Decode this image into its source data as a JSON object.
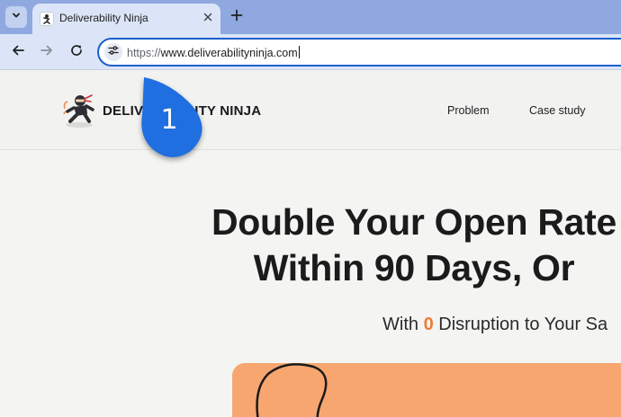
{
  "browser": {
    "tab": {
      "title": "Deliverability Ninja"
    },
    "address_bar": {
      "scheme": "https://",
      "host": "www.deliverabilityninja.com"
    }
  },
  "site": {
    "logo_text": "DELIVERABILITY NINJA",
    "nav": [
      "Problem",
      "Case study"
    ]
  },
  "hero": {
    "title_line1": "Double Your Open Rate",
    "title_line2": "Within 90 Days, Or",
    "subtitle_prefix": "With ",
    "subtitle_highlight": "0",
    "subtitle_suffix": " Disruption to Your Sa"
  },
  "annotation": {
    "step_number": "1"
  },
  "colors": {
    "tabstrip": "#8fa9e0",
    "toolbar": "#dbe5f7",
    "omnibox_focus": "#1b5fcc",
    "callout": "#1f6fe0",
    "highlight_orange": "#f07a33",
    "card_orange": "#f7a670"
  },
  "icons": {
    "tab_search": "chevron-down-icon",
    "tab_close": "close-icon",
    "new_tab": "plus-icon",
    "back": "arrow-left-icon",
    "forward": "arrow-right-icon",
    "reload": "reload-icon",
    "site_info": "tune-icon",
    "logo": "ninja-icon"
  }
}
